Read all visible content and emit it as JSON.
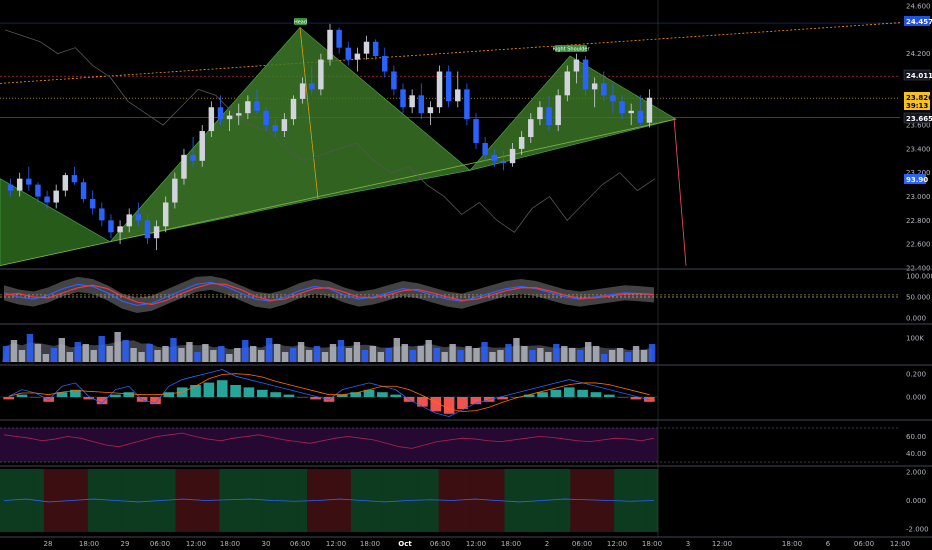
{
  "chart_data": [
    {
      "type": "candlestick",
      "panel": "price",
      "title": "",
      "ylim": [
        22.4,
        24.6
      ],
      "y_ticks": [
        "24.600",
        "24.200",
        "23.800",
        "23.600",
        "23.400",
        "23.200",
        "23.000",
        "22.800",
        "22.600",
        "22.400"
      ],
      "price_labels": {
        "upper_trend": "24.457",
        "resistance": "24.011",
        "last_price": "23.826",
        "countdown": "39:13",
        "support": "23.665",
        "overlay_value": "93.90"
      },
      "pattern": {
        "name": "Head and Shoulders",
        "head_label": "Head",
        "right_shoulder_label": "Right Shoulder"
      },
      "candles": [
        [
          23.1,
          23.15,
          23.0,
          23.05
        ],
        [
          23.05,
          23.2,
          23.0,
          23.15
        ],
        [
          23.15,
          23.25,
          23.05,
          23.1
        ],
        [
          23.1,
          23.12,
          22.95,
          23.0
        ],
        [
          23.0,
          23.05,
          22.9,
          22.95
        ],
        [
          22.95,
          23.1,
          22.9,
          23.05
        ],
        [
          23.05,
          23.2,
          23.0,
          23.18
        ],
        [
          23.18,
          23.25,
          23.1,
          23.12
        ],
        [
          23.12,
          23.15,
          22.95,
          22.98
        ],
        [
          22.98,
          23.05,
          22.85,
          22.9
        ],
        [
          22.9,
          22.95,
          22.75,
          22.8
        ],
        [
          22.8,
          22.85,
          22.65,
          22.7
        ],
        [
          22.7,
          22.8,
          22.6,
          22.75
        ],
        [
          22.75,
          22.9,
          22.7,
          22.85
        ],
        [
          22.85,
          22.95,
          22.75,
          22.8
        ],
        [
          22.8,
          22.85,
          22.6,
          22.65
        ],
        [
          22.65,
          22.8,
          22.55,
          22.75
        ],
        [
          22.75,
          23.0,
          22.7,
          22.95
        ],
        [
          22.95,
          23.2,
          22.9,
          23.15
        ],
        [
          23.15,
          23.4,
          23.1,
          23.35
        ],
        [
          23.35,
          23.5,
          23.25,
          23.3
        ],
        [
          23.3,
          23.6,
          23.25,
          23.55
        ],
        [
          23.55,
          23.8,
          23.5,
          23.75
        ],
        [
          23.75,
          23.85,
          23.6,
          23.65
        ],
        [
          23.65,
          23.72,
          23.55,
          23.68
        ],
        [
          23.68,
          23.78,
          23.6,
          23.7
        ],
        [
          23.7,
          23.85,
          23.65,
          23.8
        ],
        [
          23.8,
          23.9,
          23.7,
          23.72
        ],
        [
          23.72,
          23.75,
          23.55,
          23.6
        ],
        [
          23.6,
          23.65,
          23.5,
          23.55
        ],
        [
          23.55,
          23.7,
          23.5,
          23.65
        ],
        [
          23.65,
          23.85,
          23.6,
          23.82
        ],
        [
          23.82,
          24.0,
          23.78,
          23.95
        ],
        [
          23.95,
          24.1,
          23.85,
          23.9
        ],
        [
          23.9,
          24.2,
          23.85,
          24.15
        ],
        [
          24.15,
          24.45,
          24.1,
          24.4
        ],
        [
          24.4,
          24.42,
          24.2,
          24.25
        ],
        [
          24.25,
          24.3,
          24.1,
          24.15
        ],
        [
          24.15,
          24.25,
          24.05,
          24.2
        ],
        [
          24.2,
          24.35,
          24.15,
          24.3
        ],
        [
          24.3,
          24.32,
          24.15,
          24.18
        ],
        [
          24.18,
          24.25,
          24.0,
          24.05
        ],
        [
          24.05,
          24.1,
          23.85,
          23.9
        ],
        [
          23.9,
          23.95,
          23.7,
          23.75
        ],
        [
          23.75,
          23.9,
          23.7,
          23.85
        ],
        [
          23.85,
          23.95,
          23.65,
          23.7
        ],
        [
          23.7,
          23.8,
          23.6,
          23.75
        ],
        [
          23.75,
          24.1,
          23.7,
          24.05
        ],
        [
          24.05,
          24.1,
          23.75,
          23.8
        ],
        [
          23.8,
          24.05,
          23.75,
          23.9
        ],
        [
          23.9,
          23.95,
          23.6,
          23.65
        ],
        [
          23.65,
          23.7,
          23.4,
          23.45
        ],
        [
          23.45,
          23.5,
          23.3,
          23.35
        ],
        [
          23.35,
          23.4,
          23.25,
          23.3
        ],
        [
          23.3,
          23.38,
          23.22,
          23.28
        ],
        [
          23.28,
          23.45,
          23.25,
          23.4
        ],
        [
          23.4,
          23.55,
          23.35,
          23.5
        ],
        [
          23.5,
          23.7,
          23.45,
          23.65
        ],
        [
          23.65,
          23.8,
          23.6,
          23.75
        ],
        [
          23.75,
          23.85,
          23.55,
          23.6
        ],
        [
          23.6,
          23.9,
          23.55,
          23.85
        ],
        [
          23.85,
          24.1,
          23.8,
          24.05
        ],
        [
          24.05,
          24.2,
          23.95,
          24.15
        ],
        [
          24.15,
          24.18,
          23.85,
          23.9
        ],
        [
          23.9,
          24.0,
          23.75,
          23.95
        ],
        [
          23.95,
          24.05,
          23.8,
          23.85
        ],
        [
          23.85,
          23.95,
          23.7,
          23.8
        ],
        [
          23.8,
          23.85,
          23.65,
          23.7
        ],
        [
          23.7,
          23.78,
          23.6,
          23.72
        ],
        [
          23.72,
          23.85,
          23.6,
          23.62
        ],
        [
          23.62,
          23.9,
          23.58,
          23.83
        ]
      ]
    },
    {
      "type": "line",
      "panel": "stochastic_rsi",
      "ylim": [
        0,
        100
      ],
      "y_ticks": [
        "100.000",
        "50.000",
        "0.000"
      ],
      "series": [
        {
          "name": "",
          "color": "#2962ff",
          "values": [
            60,
            50,
            45,
            55,
            70,
            80,
            75,
            60,
            40,
            30,
            35,
            50,
            65,
            80,
            85,
            75,
            60,
            45,
            40,
            50,
            65,
            75,
            70,
            55,
            45,
            50,
            60,
            70,
            65,
            55,
            45,
            40,
            50,
            60,
            70,
            75,
            70,
            60,
            50,
            45,
            50,
            55,
            60,
            58,
            55
          ]
        },
        {
          "name": "",
          "color": "#f23645",
          "values": [
            55,
            58,
            50,
            48,
            60,
            72,
            78,
            70,
            52,
            38,
            32,
            42,
            58,
            72,
            82,
            80,
            68,
            52,
            42,
            45,
            58,
            70,
            72,
            62,
            50,
            48,
            55,
            65,
            68,
            60,
            50,
            42,
            45,
            55,
            65,
            72,
            72,
            64,
            54,
            47,
            48,
            52,
            57,
            58,
            56
          ]
        }
      ],
      "color_area": "#c0c0c0"
    },
    {
      "type": "bar",
      "panel": "volume",
      "y_ticks": [
        "100K"
      ],
      "values": [
        40,
        55,
        30,
        70,
        45,
        20,
        35,
        60,
        25,
        50,
        45,
        30,
        65,
        40,
        75,
        55,
        35,
        25,
        45,
        30,
        40,
        60,
        35,
        50,
        25,
        45,
        30,
        40,
        20,
        35,
        55,
        40,
        30,
        60,
        45,
        25,
        35,
        50,
        30,
        40,
        25,
        45,
        55,
        35,
        50,
        30,
        40,
        25,
        35,
        60,
        45,
        30,
        40,
        55,
        35,
        25,
        45,
        30,
        40,
        35,
        50,
        25,
        30,
        45,
        60,
        40,
        30,
        35,
        25,
        45,
        40,
        35,
        30,
        50,
        40,
        20,
        30,
        35,
        25,
        40,
        30,
        45
      ]
    },
    {
      "type": "histogram",
      "panel": "macd",
      "y_ticks": [
        "0.200",
        "0.000"
      ],
      "values": [
        -0.01,
        0.01,
        0.0,
        -0.02,
        0.02,
        0.03,
        -0.01,
        -0.03,
        0.01,
        0.02,
        -0.02,
        -0.03,
        0.02,
        0.04,
        0.05,
        0.06,
        0.07,
        0.05,
        0.04,
        0.03,
        0.02,
        0.01,
        0.0,
        -0.01,
        -0.02,
        0.01,
        0.02,
        0.03,
        0.02,
        0.01,
        -0.02,
        -0.04,
        -0.06,
        -0.07,
        -0.05,
        -0.03,
        -0.02,
        -0.01,
        0.0,
        0.01,
        0.02,
        0.03,
        0.04,
        0.03,
        0.02,
        0.01,
        0.0,
        -0.01,
        -0.02
      ]
    },
    {
      "type": "line",
      "panel": "rsi",
      "y_ticks": [
        "60.00",
        "40.00"
      ],
      "values": [
        62,
        60,
        58,
        55,
        57,
        60,
        58,
        54,
        50,
        48,
        52,
        56,
        60,
        62,
        64,
        60,
        57,
        55,
        58,
        60,
        62,
        59,
        56,
        54,
        52,
        55,
        58,
        60,
        58,
        56,
        52,
        48,
        46,
        50,
        54,
        56,
        58,
        57,
        55,
        54,
        56,
        58,
        60,
        59,
        57,
        55,
        54,
        56,
        58,
        57,
        55,
        58
      ]
    },
    {
      "type": "line",
      "panel": "oscillator",
      "y_ticks": [
        "2.000",
        "0.000",
        "-2.000"
      ],
      "values": [
        0.0,
        0.1,
        -0.1,
        0.0,
        0.1,
        0.0,
        -0.1,
        0.0,
        0.1,
        0.0,
        0.05,
        0.1,
        0.0,
        -0.05,
        0.0,
        0.1,
        0.0,
        -0.1,
        0.0,
        0.05,
        0.0,
        0.1,
        0.0,
        -0.1,
        0.0,
        0.1,
        0.05,
        0.0,
        -0.05,
        0.0
      ]
    },
    {
      "type": "time_axis",
      "labels": [
        "28",
        "18:00",
        "29",
        "06:00",
        "12:00",
        "18:00",
        "30",
        "06:00",
        "12:00",
        "18:00",
        "Oct",
        "06:00",
        "12:00",
        "18:00",
        "2",
        "06:00",
        "12:00",
        "18:00",
        "3",
        "12:00",
        "18:00",
        "6",
        "06:00",
        "12:00"
      ]
    }
  ]
}
